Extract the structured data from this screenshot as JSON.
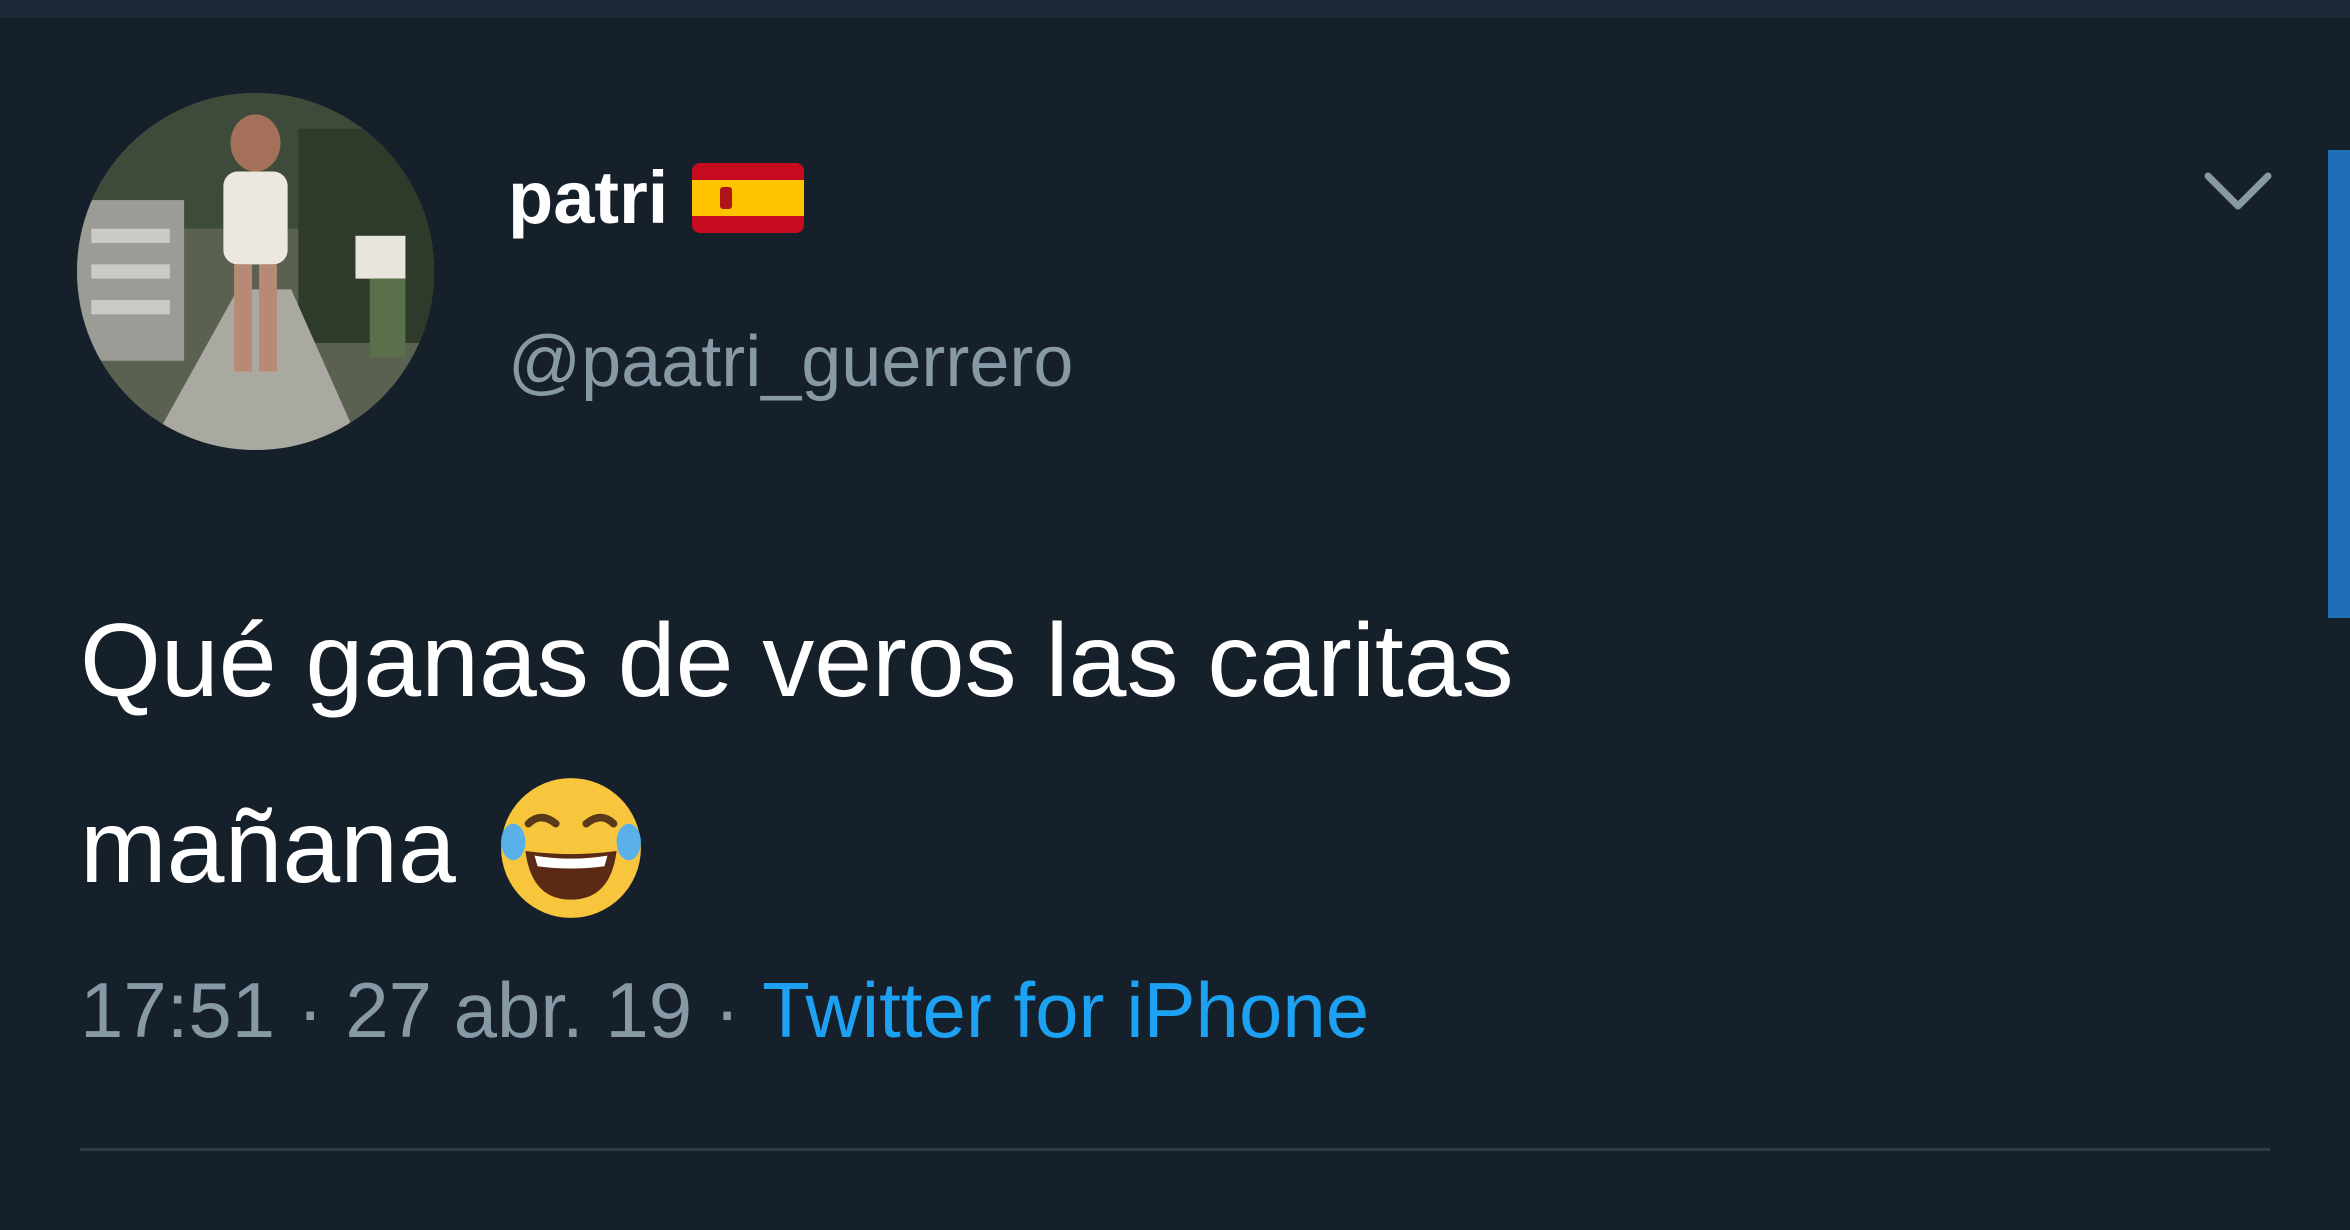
{
  "tweet": {
    "display_name": "patri",
    "handle": "@paatri_guerrero",
    "text_line1": "Qué ganas de veros las caritas",
    "text_line2": "mañana",
    "time": "17:51",
    "date": "27 abr. 19",
    "separator": "·",
    "source": "Twitter for iPhone"
  },
  "icons": {
    "flag": "spain-flag-icon",
    "emoji": "face-with-tears-of-joy-icon",
    "menu": "chevron-down-icon"
  },
  "colors": {
    "background": "#15202b",
    "secondary_text": "#8899a6",
    "link": "#1da1f2"
  }
}
